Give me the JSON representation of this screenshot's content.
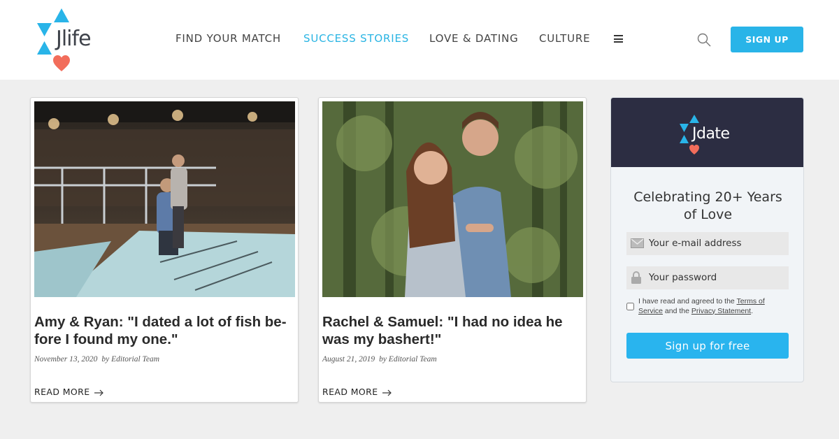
{
  "header": {
    "logo_text": "Jlife",
    "nav": [
      {
        "label": "FIND YOUR MATCH",
        "active": false
      },
      {
        "label": "SUCCESS STORIES",
        "active": true
      },
      {
        "label": "LOVE & DATING",
        "active": false
      },
      {
        "label": "CULTURE",
        "active": false
      }
    ],
    "signup_label": "SIGN UP"
  },
  "cards": [
    {
      "title": "Amy & Ryan: \"I dated a lot of fish be-fore I found my one.\"",
      "date": "November 13, 2020",
      "author": "by Editorial Team",
      "read_more": "READ MORE"
    },
    {
      "title": "Rachel & Samuel: \"I had no idea he was my bashert!\"",
      "date": "August 21, 2019",
      "author": "by Editorial Team",
      "read_more": "READ MORE"
    }
  ],
  "sidebar": {
    "logo_text": "Jdate",
    "title_line1": "Celebrating 20+ Years",
    "title_line2": "of Love",
    "email_placeholder": "Your e-mail address",
    "password_placeholder": "Your password",
    "terms_prefix": "I have read and agreed to the ",
    "terms_link": "Terms of Service",
    "terms_middle": " and the ",
    "privacy_link": "Privacy Statement",
    "terms_suffix": ".",
    "button_label": "Sign up for free"
  },
  "colors": {
    "accent": "#29b4e8",
    "heart": "#f26d5b",
    "sidebar_dark": "#2c2d42"
  },
  "icons": [
    "star-of-david-logo-icon",
    "heart-icon",
    "hamburger-menu-icon",
    "search-icon",
    "envelope-icon",
    "lock-icon",
    "arrow-right-icon"
  ]
}
